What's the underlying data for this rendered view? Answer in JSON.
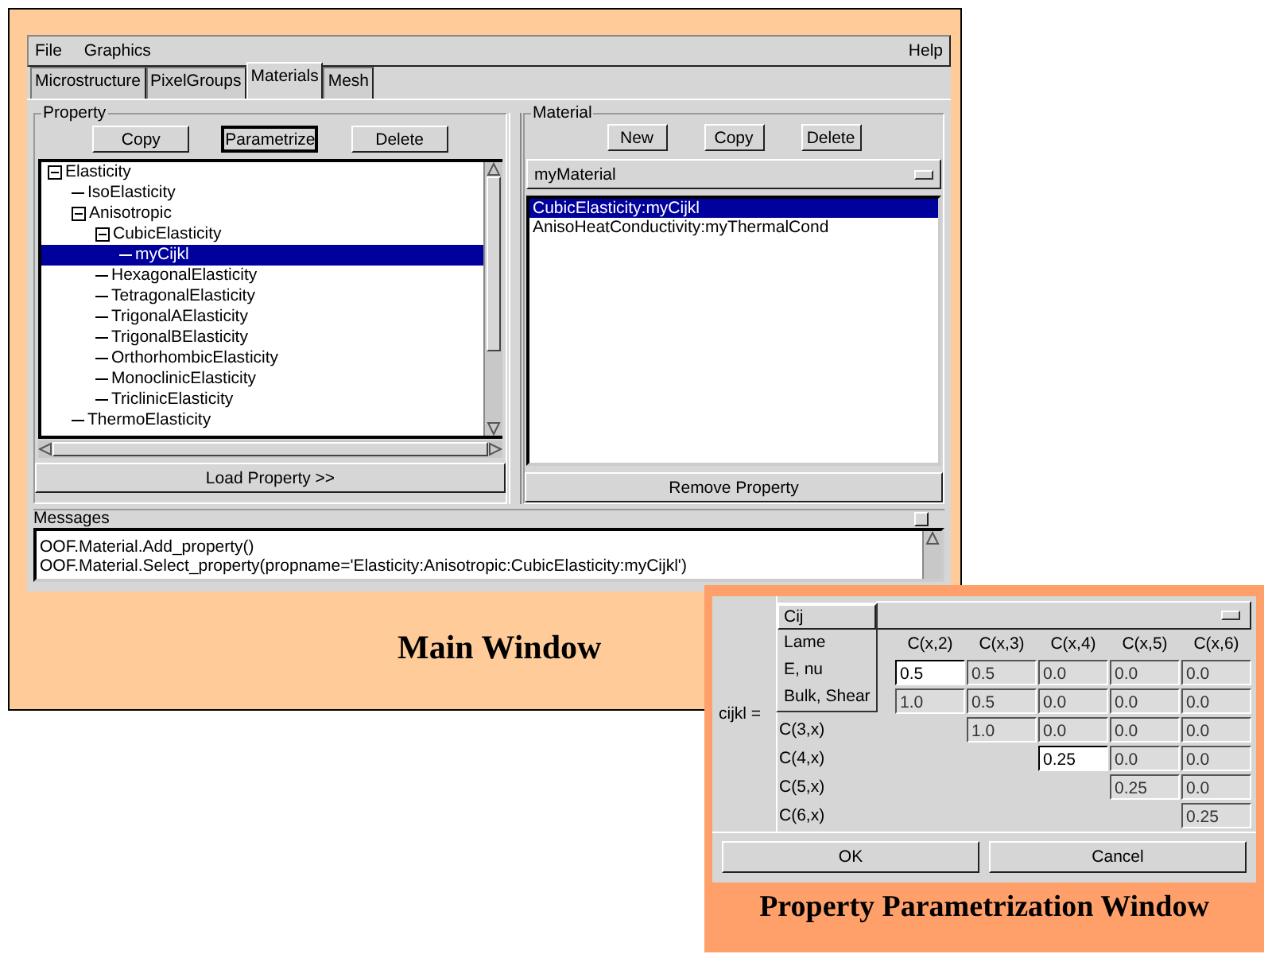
{
  "main_window": {
    "menu": [
      {
        "label": "File"
      },
      {
        "label": "Graphics"
      },
      {
        "label": "Help"
      }
    ],
    "tabs": [
      {
        "label": "Microstructure",
        "selected": false
      },
      {
        "label": "PixelGroups",
        "selected": false
      },
      {
        "label": "Materials",
        "selected": true
      },
      {
        "label": "Mesh",
        "selected": false
      }
    ],
    "property_panel": {
      "title": "Property",
      "buttons": [
        {
          "label": "Copy",
          "focused": false
        },
        {
          "label": "Parametrize",
          "focused": true
        },
        {
          "label": "Delete",
          "focused": false
        }
      ],
      "tree": [
        {
          "label": "Elasticity",
          "expanded": true,
          "selected": false,
          "children": [
            {
              "label": "IsoElasticity",
              "selected": false
            },
            {
              "label": "Anisotropic",
              "expanded": true,
              "selected": false,
              "children": [
                {
                  "label": "CubicElasticity",
                  "expanded": true,
                  "selected": false,
                  "children": [
                    {
                      "label": "myCijkl",
                      "selected": true
                    }
                  ]
                },
                {
                  "label": "HexagonalElasticity",
                  "selected": false
                },
                {
                  "label": "TetragonalElasticity",
                  "selected": false
                },
                {
                  "label": "TrigonalAElasticity",
                  "selected": false
                },
                {
                  "label": "TrigonalBElasticity",
                  "selected": false
                },
                {
                  "label": "OrthorhombicElasticity",
                  "selected": false
                },
                {
                  "label": "MonoclinicElasticity",
                  "selected": false
                },
                {
                  "label": "TriclinicElasticity",
                  "selected": false
                }
              ]
            },
            {
              "label": "ThermoElasticity",
              "selected": false
            }
          ]
        }
      ],
      "load_button": "Load Property >>"
    },
    "material_panel": {
      "title": "Material",
      "buttons": [
        {
          "label": "New"
        },
        {
          "label": "Copy"
        },
        {
          "label": "Delete"
        }
      ],
      "material_select": "myMaterial",
      "properties": [
        {
          "label": "CubicElasticity:myCijkl",
          "selected": true
        },
        {
          "label": "AnisoHeatConductivity:myThermalCond",
          "selected": false
        }
      ],
      "remove_button": "Remove Property"
    },
    "messages": {
      "title": "Messages",
      "lines": [
        "OOF.Material.Add_property()",
        "OOF.Material.Select_property(propname='Elasticity:Anisotropic:CubicElasticity:myCijkl')"
      ]
    },
    "caption": "Main Window"
  },
  "parametrization_window": {
    "matrix_label": "cijkl =",
    "selector": {
      "value": "Cij",
      "expanded": true,
      "options": [
        "Lame",
        "E, nu",
        "Bulk, Shear"
      ]
    },
    "columns": [
      "C(x,2)",
      "C(x,3)",
      "C(x,4)",
      "C(x,5)",
      "C(x,6)"
    ],
    "rows": [
      {
        "cells": [
          {
            "value": "0.5",
            "editable": true
          },
          {
            "value": "0.5",
            "editable": false
          },
          {
            "value": "0.0",
            "editable": false
          },
          {
            "value": "0.0",
            "editable": false
          },
          {
            "value": "0.0",
            "editable": false
          }
        ]
      },
      {
        "cells": [
          {
            "value": "1.0",
            "editable": false
          },
          {
            "value": "0.5",
            "editable": false
          },
          {
            "value": "0.0",
            "editable": false
          },
          {
            "value": "0.0",
            "editable": false
          },
          {
            "value": "0.0",
            "editable": false
          }
        ]
      },
      {
        "label": "C(3,x)",
        "cells": [
          null,
          {
            "value": "1.0",
            "editable": false
          },
          {
            "value": "0.0",
            "editable": false
          },
          {
            "value": "0.0",
            "editable": false
          },
          {
            "value": "0.0",
            "editable": false
          }
        ]
      },
      {
        "label": "C(4,x)",
        "cells": [
          null,
          null,
          {
            "value": "0.25",
            "editable": true
          },
          {
            "value": "0.0",
            "editable": false
          },
          {
            "value": "0.0",
            "editable": false
          }
        ]
      },
      {
        "label": "C(5,x)",
        "cells": [
          null,
          null,
          null,
          {
            "value": "0.25",
            "editable": false
          },
          {
            "value": "0.0",
            "editable": false
          }
        ]
      },
      {
        "label": "C(6,x)",
        "cells": [
          null,
          null,
          null,
          null,
          {
            "value": "0.25",
            "editable": false
          }
        ]
      }
    ],
    "buttons": [
      "OK",
      "Cancel"
    ],
    "caption": "Property Parametrization Window"
  }
}
